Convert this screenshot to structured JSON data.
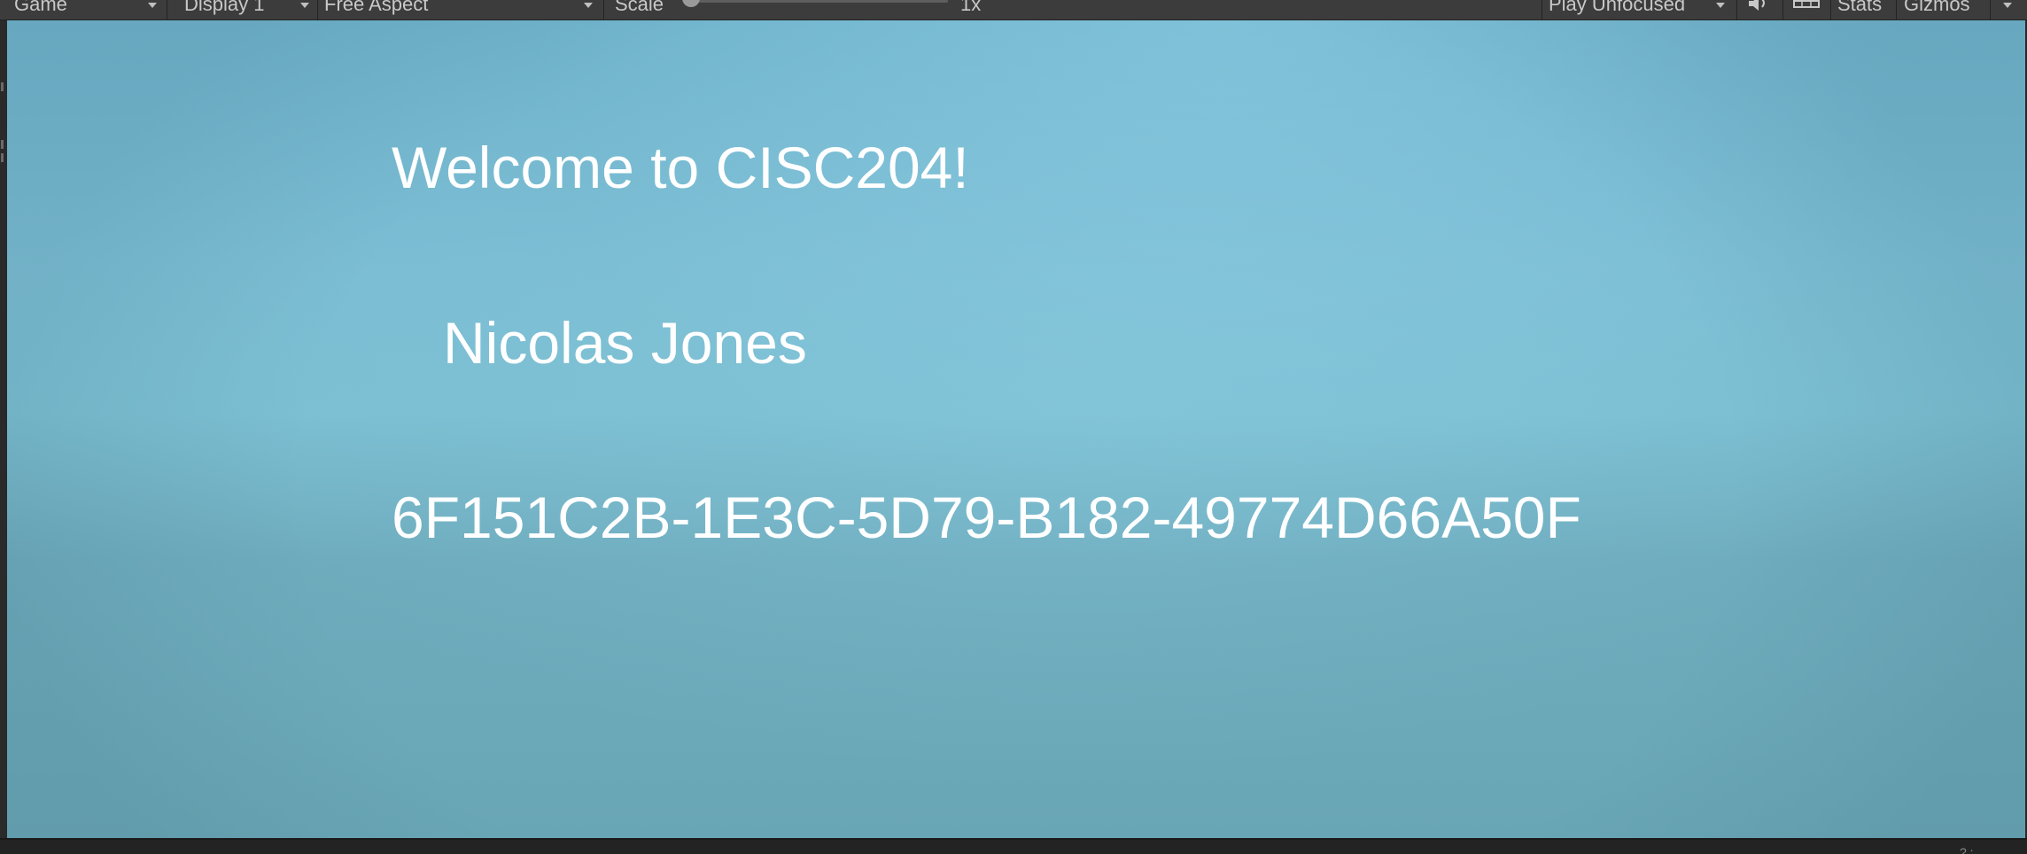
{
  "toolbar": {
    "view_mode": "Game",
    "display": "Display 1",
    "aspect": "Free Aspect",
    "scale_label": "Scale",
    "scale_value": "1x",
    "play_mode": "Play Unfocused",
    "stats_label": "Stats",
    "gizmos_label": "Gizmos"
  },
  "game_view": {
    "welcome_text": "Welcome to CISC204!",
    "name_text": "Nicolas Jones",
    "id_text": "6F151C2B-1E3C-5D79-B182-49774D66A50F"
  },
  "status_bar": {
    "glyph": "? :"
  },
  "colors": {
    "toolbar_bg": "#3c3c3c",
    "viewport_sky": "#7bbdd3",
    "text": "#ffffff"
  }
}
